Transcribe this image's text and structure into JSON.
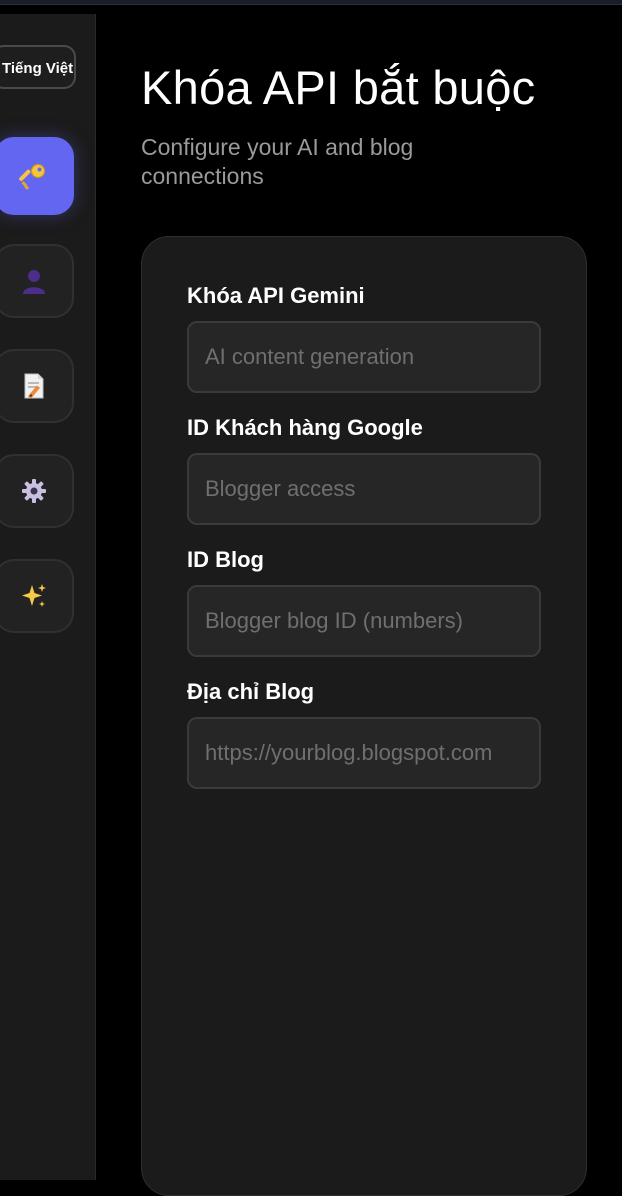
{
  "language": {
    "label": "Tiếng Việt"
  },
  "nav": {
    "items": [
      {
        "icon": "key-icon",
        "active": true
      },
      {
        "icon": "user-icon",
        "active": false
      },
      {
        "icon": "memo-icon",
        "active": false
      },
      {
        "icon": "gear-icon",
        "active": false
      },
      {
        "icon": "sparkles-icon",
        "active": false
      }
    ]
  },
  "page": {
    "title": "Khóa API bắt buộc",
    "subtitle": "Configure your AI and blog connections"
  },
  "form": {
    "fields": [
      {
        "label": "Khóa API Gemini",
        "placeholder": "AI content generation",
        "value": ""
      },
      {
        "label": "ID Khách hàng Google",
        "placeholder": "Blogger access",
        "value": ""
      },
      {
        "label": "ID Blog",
        "placeholder": "Blogger blog ID (numbers)",
        "value": ""
      },
      {
        "label": "Địa chỉ Blog",
        "placeholder": "https://yourblog.blogspot.com",
        "value": ""
      }
    ]
  },
  "colors": {
    "accent": "#6366f1",
    "background": "#000000",
    "sidebar": "#1b1b1b",
    "card": "#1b1b1b"
  }
}
